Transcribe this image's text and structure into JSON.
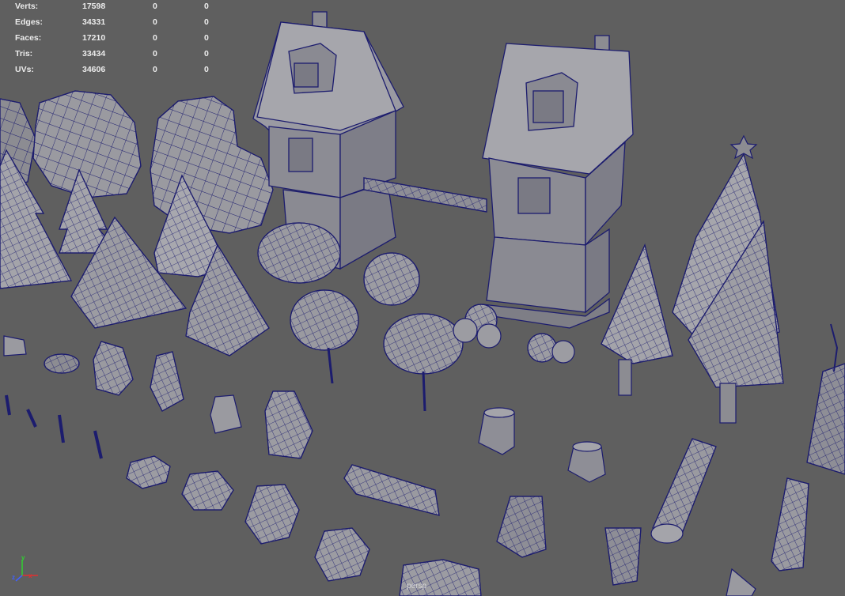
{
  "hud": {
    "rows": [
      {
        "label": "Verts:",
        "value": "17598",
        "c2": "0",
        "c3": "0"
      },
      {
        "label": "Edges:",
        "value": "34331",
        "c2": "0",
        "c3": "0"
      },
      {
        "label": "Faces:",
        "value": "17210",
        "c2": "0",
        "c3": "0"
      },
      {
        "label": "Tris:",
        "value": "33434",
        "c2": "0",
        "c3": "0"
      },
      {
        "label": "UVs:",
        "value": "34606",
        "c2": "0",
        "c3": "0"
      }
    ]
  },
  "camera": {
    "label": "persp"
  },
  "axis": {
    "x": "x",
    "y": "y",
    "z": "z"
  },
  "colors": {
    "background": "#5f5f5f",
    "mesh_fill": "#8c8c92",
    "mesh_light": "#a9a9b0",
    "mesh_dark": "#6f6f78",
    "wire": "#1c1c6e",
    "hud_text": "#ececec"
  },
  "icons": [
    "axis-gizmo-icon"
  ]
}
